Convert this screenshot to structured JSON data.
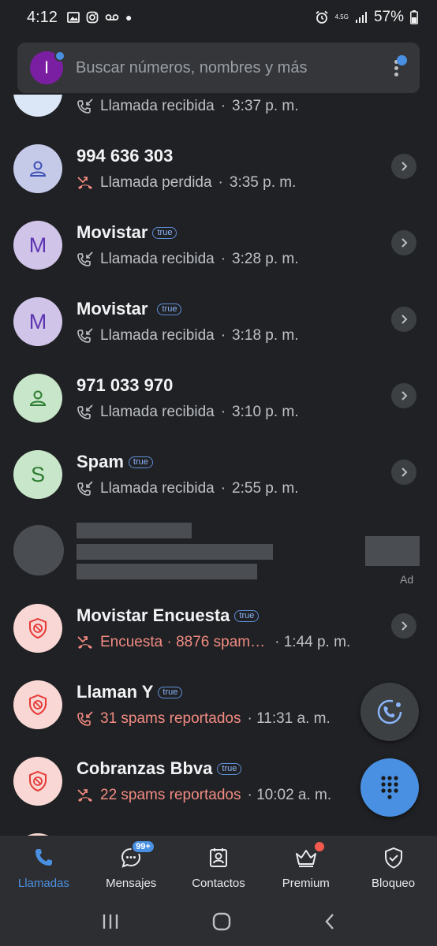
{
  "status_bar": {
    "time": "4:12",
    "network": "4.5G",
    "battery": "57%"
  },
  "search": {
    "placeholder": "Buscar números, nombres y más",
    "avatar_letter": "I"
  },
  "calls": [
    {
      "name": "",
      "detail": "Llamada recibida",
      "time": "3:37 p. m.",
      "type": "received"
    },
    {
      "name": "994 636 303",
      "detail": "Llamada perdida",
      "time": "3:35 p. m.",
      "type": "missed",
      "avatar_color": "#c5cae9",
      "avatar_fg": "#3f51b5"
    },
    {
      "name": "Movistar",
      "badge": "true",
      "avatar_letter": "M",
      "detail": "Llamada recibida",
      "time": "3:28 p. m.",
      "type": "received",
      "avatar_color": "#d1c4e9",
      "avatar_fg": "#5e35b1"
    },
    {
      "name": "Movistar",
      "badge": "true",
      "avatar_letter": "M",
      "detail": "Llamada recibida",
      "time": "3:18 p. m.",
      "type": "received",
      "avatar_color": "#d1c4e9",
      "avatar_fg": "#5e35b1"
    },
    {
      "name": "971 033 970",
      "detail": "Llamada recibida",
      "time": "3:10 p. m.",
      "type": "received",
      "avatar_color": "#c8e6c9",
      "avatar_fg": "#2e7d32"
    },
    {
      "name": "Spam",
      "badge": "true",
      "avatar_letter": "S",
      "detail": "Llamada recibida",
      "time": "2:55 p. m.",
      "type": "received",
      "avatar_color": "#c8e6c9",
      "avatar_fg": "#2e7d32"
    },
    {
      "name": "Movistar Encuesta",
      "badge": "true",
      "detail": "Encuesta · 8876 spam…",
      "time": " · 1:44 p. m.",
      "type": "spam-missed",
      "avatar_color": "#f8d7d4"
    },
    {
      "name": "Llaman Y",
      "badge": "true",
      "detail": "31 spams reportados",
      "time": "· 11:31 a. m.",
      "type": "spam-received",
      "avatar_color": "#f8d7d4"
    },
    {
      "name": "Cobranzas Bbva",
      "badge": "true",
      "detail": "22 spams reportados",
      "time": "· 10:02 a. m.",
      "type": "spam-missed",
      "avatar_color": "#f8d7d4"
    }
  ],
  "ad": {
    "label": "Ad"
  },
  "nav": {
    "items": [
      {
        "label": "Llamadas"
      },
      {
        "label": "Mensajes",
        "badge": "99+"
      },
      {
        "label": "Contactos"
      },
      {
        "label": "Premium"
      },
      {
        "label": "Bloqueo"
      }
    ]
  },
  "colors": {
    "accent": "#4a90e2",
    "spam_red": "#f28b82",
    "background": "#202124"
  }
}
